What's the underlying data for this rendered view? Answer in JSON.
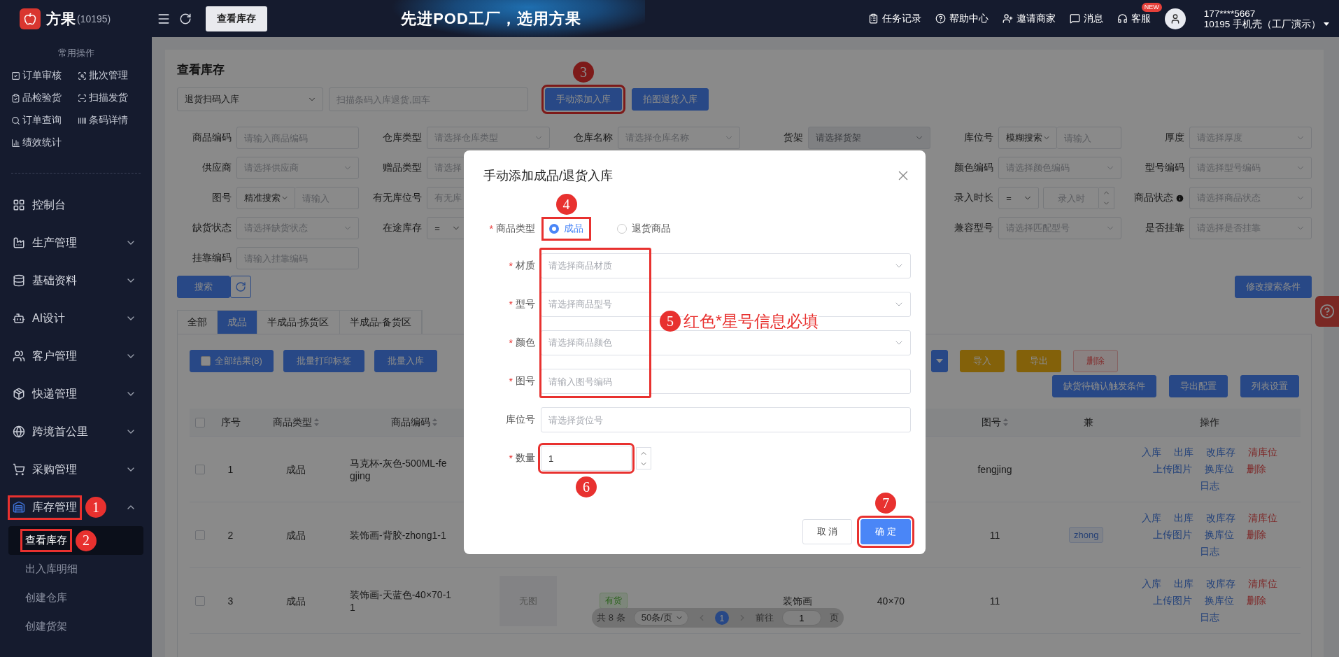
{
  "topbar": {
    "brand": "方果",
    "brand_id": "(10195)",
    "page_button": "查看库存",
    "slogan": "先进POD工厂，选用方果",
    "links": [
      {
        "label": "任务记录"
      },
      {
        "label": "帮助中心"
      },
      {
        "label": "邀请商家"
      },
      {
        "label": "消息"
      },
      {
        "label": "客服",
        "badge": "NEW"
      }
    ],
    "user": {
      "phone": "177****5667",
      "account": "10195 手机壳（工厂演示）"
    }
  },
  "sidebar": {
    "quick_title": "常用操作",
    "quick_actions": [
      "订单审核",
      "批次管理",
      "品检验货",
      "扫描发货",
      "订单查询",
      "条码详情",
      "绩效统计"
    ],
    "menu": [
      {
        "label": "控制台"
      },
      {
        "label": "生产管理",
        "expandable": true,
        "expanded": false
      },
      {
        "label": "基础资料",
        "expandable": true,
        "expanded": false
      },
      {
        "label": "AI设计",
        "expandable": true,
        "expanded": false
      },
      {
        "label": "客户管理",
        "expandable": true,
        "expanded": false
      },
      {
        "label": "快递管理",
        "expandable": true,
        "expanded": false
      },
      {
        "label": "跨境首公里",
        "expandable": true,
        "expanded": false
      },
      {
        "label": "采购管理",
        "expandable": true,
        "expanded": false
      },
      {
        "label": "库存管理",
        "expandable": true,
        "expanded": true,
        "marker": "1",
        "children": [
          {
            "label": "查看库存",
            "selected": true,
            "marker": "2"
          },
          {
            "label": "出入库明细",
            "selected": false
          },
          {
            "label": "创建仓库",
            "selected": false
          },
          {
            "label": "创建货架",
            "selected": false
          }
        ]
      }
    ]
  },
  "page": {
    "title": "查看库存",
    "scan_mode": "退货扫码入库",
    "scan_placeholder": "扫描条码入库退货,回车",
    "scan_buttons": [
      {
        "label": "手动添加入库",
        "marker": "3"
      },
      {
        "label": "拍图退货入库"
      }
    ],
    "filters": [
      [
        {
          "kind": "input",
          "label": "商品编码",
          "placeholder": "请输入商品编码",
          "disabled": false
        },
        {
          "kind": "select",
          "label": "仓库类型",
          "placeholder": "请选择仓库类型",
          "disabled": false
        },
        {
          "kind": "select",
          "label": "仓库名称",
          "placeholder": "请选择仓库名称",
          "disabled": false
        },
        {
          "kind": "select",
          "label": "货架",
          "placeholder": "请选择货架",
          "disabled": true
        },
        {
          "kind": "combo",
          "label": "库位号",
          "mode": "模糊搜索",
          "placeholder": "请输入",
          "disabled": false
        },
        {
          "kind": "select",
          "label": "厚度",
          "placeholder": "请选择厚度",
          "disabled": false
        }
      ],
      [
        {
          "kind": "select",
          "label": "供应商",
          "placeholder": "请选择供应商",
          "disabled": false
        },
        {
          "kind": "cut",
          "label": "赠品类型",
          "placeholder": "请选择",
          "disabled": false
        },
        {
          "kind": "covered"
        },
        {
          "kind": "covered"
        },
        {
          "kind": "select",
          "label": "颜色编码",
          "placeholder": "请选择颜色编码",
          "disabled": false
        },
        {
          "kind": "select",
          "label": "型号编码",
          "placeholder": "请选择型号编码",
          "disabled": false
        }
      ],
      [
        {
          "kind": "combo",
          "label": "图号",
          "mode": "精准搜索",
          "placeholder": "请输入",
          "disabled": false
        },
        {
          "kind": "cut",
          "label": "有无库位号",
          "placeholder": "有无库",
          "disabled": false
        },
        {
          "kind": "covered"
        },
        {
          "kind": "covered"
        },
        {
          "kind": "compare",
          "label": "录入时长",
          "mode": "=",
          "placeholder": "录入时",
          "disabled": false
        },
        {
          "kind": "select",
          "label": "商品状态",
          "info": true,
          "placeholder": "请选择商品状态",
          "disabled": false
        }
      ],
      [
        {
          "kind": "select",
          "label": "缺货状态",
          "placeholder": "请选择缺货状态",
          "disabled": false
        },
        {
          "kind": "compare",
          "label": "在途库存",
          "mode": "=",
          "disabled": false
        },
        {
          "kind": "covered"
        },
        {
          "kind": "covered"
        },
        {
          "kind": "select",
          "label": "兼容型号",
          "placeholder": "请选择匹配型号",
          "disabled": false
        },
        {
          "kind": "select",
          "label": "是否挂靠",
          "placeholder": "请选择是否挂靠",
          "disabled": false
        }
      ],
      [
        {
          "kind": "input",
          "label": "挂靠编码",
          "placeholder": "请输入挂靠编码",
          "disabled": false
        }
      ]
    ],
    "search_button": "搜索",
    "edit_conditions_button": "修改搜索条件",
    "tabs": [
      {
        "label": "全部",
        "selected": false
      },
      {
        "label": "成品",
        "selected": true
      },
      {
        "label": "半成品-拣货区",
        "selected": false
      },
      {
        "label": "半成品-备货区",
        "selected": false
      }
    ],
    "toolbar_left": [
      {
        "kind": "check",
        "label": "全部结果(8)",
        "checked": false
      },
      {
        "kind": "primary",
        "label": "批量打印标签"
      },
      {
        "kind": "primary",
        "label": "批量入库"
      }
    ],
    "toolbar_right": [
      {
        "kind": "caret"
      },
      {
        "kind": "warning",
        "label": "导入"
      },
      {
        "kind": "warning",
        "label": "导出"
      },
      {
        "kind": "danger",
        "label": "删除"
      }
    ],
    "toolbar_second": [
      {
        "kind": "primary",
        "label": "缺货待确认触发条件"
      },
      {
        "kind": "primary",
        "label": "导出配置"
      },
      {
        "kind": "primary",
        "label": "列表设置"
      }
    ],
    "table": {
      "columns": [
        {
          "kind": "checkbox",
          "checked": false
        },
        {
          "kind": "label",
          "label": "序号",
          "sortable": false
        },
        {
          "kind": "label",
          "label": "商品类型",
          "sortable": true
        },
        {
          "kind": "label",
          "label": "商品编码",
          "sortable": true
        },
        {
          "kind": "covered"
        },
        {
          "kind": "covered"
        },
        {
          "kind": "covered"
        },
        {
          "kind": "covered"
        },
        {
          "kind": "covered"
        },
        {
          "kind": "label",
          "label": "图号",
          "sortable": true
        },
        {
          "kind": "label",
          "label": "兼",
          "sortable": false
        },
        {
          "kind": "label",
          "label": "操作",
          "sortable": false
        }
      ],
      "rows": [
        {
          "cells": [
            {
              "kind": "checkbox",
              "checked": false
            },
            {
              "kind": "text",
              "text": "1"
            },
            {
              "kind": "text",
              "text": "成品"
            },
            {
              "kind": "lines",
              "lines": [
                "马克杯-灰色-500ML-fe",
                "gjing"
              ]
            },
            {
              "kind": "covered"
            },
            {
              "kind": "covered"
            },
            {
              "kind": "covered"
            },
            {
              "kind": "covered"
            },
            {
              "kind": "covered"
            },
            {
              "kind": "text",
              "text": "fengjing"
            },
            {
              "kind": "empty"
            },
            {
              "kind": "ops",
              "lines": [
                [
                  {
                    "label": "入库",
                    "danger": false
                  },
                  {
                    "label": "出库",
                    "danger": false
                  },
                  {
                    "label": "改库存",
                    "danger": false
                  },
                  {
                    "label": "清库位",
                    "danger": true
                  }
                ],
                [
                  {
                    "label": "上传图片",
                    "danger": false
                  },
                  {
                    "label": "换库位",
                    "danger": false
                  },
                  {
                    "label": "删除",
                    "danger": true
                  }
                ],
                [
                  {
                    "label": "日志",
                    "danger": false
                  }
                ]
              ]
            }
          ]
        },
        {
          "cells": [
            {
              "kind": "checkbox",
              "checked": false
            },
            {
              "kind": "text",
              "text": "2"
            },
            {
              "kind": "text",
              "text": "成品"
            },
            {
              "kind": "lines",
              "lines": [
                "装饰画-背胶-zhong1-1"
              ]
            },
            {
              "kind": "covered"
            },
            {
              "kind": "covered"
            },
            {
              "kind": "covered"
            },
            {
              "kind": "covered"
            },
            {
              "kind": "covered"
            },
            {
              "kind": "text",
              "text": "11"
            },
            {
              "kind": "chip",
              "text": "zhong"
            },
            {
              "kind": "ops",
              "lines": [
                [
                  {
                    "label": "入库",
                    "danger": false
                  },
                  {
                    "label": "出库",
                    "danger": false
                  },
                  {
                    "label": "改库存",
                    "danger": false
                  },
                  {
                    "label": "清库位",
                    "danger": true
                  }
                ],
                [
                  {
                    "label": "上传图片",
                    "danger": false
                  },
                  {
                    "label": "换库位",
                    "danger": false
                  },
                  {
                    "label": "删除",
                    "danger": true
                  }
                ],
                [
                  {
                    "label": "日志",
                    "danger": false
                  }
                ]
              ]
            }
          ]
        },
        {
          "cells": [
            {
              "kind": "checkbox",
              "checked": false
            },
            {
              "kind": "text",
              "text": "3"
            },
            {
              "kind": "text",
              "text": "成品"
            },
            {
              "kind": "lines",
              "lines": [
                "装饰画-天蓝色-40×70-1",
                "1"
              ]
            },
            {
              "kind": "image",
              "text": "无图"
            },
            {
              "kind": "status",
              "text": "有货"
            },
            {
              "kind": "empty"
            },
            {
              "kind": "text",
              "text": "装饰画"
            },
            {
              "kind": "text",
              "text": "40×70"
            },
            {
              "kind": "text",
              "text": "11"
            },
            {
              "kind": "empty"
            },
            {
              "kind": "ops",
              "lines": [
                [
                  {
                    "label": "入库",
                    "danger": false
                  },
                  {
                    "label": "出库",
                    "danger": false
                  },
                  {
                    "label": "改库存",
                    "danger": false
                  },
                  {
                    "label": "清库位",
                    "danger": true
                  }
                ],
                [
                  {
                    "label": "上传图片",
                    "danger": false
                  },
                  {
                    "label": "换库位",
                    "danger": false
                  },
                  {
                    "label": "删除",
                    "danger": true
                  }
                ],
                [
                  {
                    "label": "日志",
                    "danger": false
                  }
                ]
              ]
            }
          ]
        }
      ]
    },
    "pagination": {
      "total": "共 8 条",
      "page_size": "50条/页",
      "pages": [
        {
          "label": "1",
          "selected": true
        }
      ],
      "goto_label": "前往",
      "goto_value": "1",
      "goto_suffix": "页"
    }
  },
  "dialog": {
    "title": "手动添加成品/退货入库",
    "type_label": "商品类型",
    "type_required": true,
    "type_required_mark": "*",
    "type_options": [
      {
        "label": "成品",
        "selected": true,
        "marker": "4"
      },
      {
        "label": "退货商品",
        "selected": false
      }
    ],
    "marked_fields": [
      {
        "label": "材质",
        "required": true,
        "required_mark": "*",
        "kind": "select",
        "placeholder": "请选择商品材质"
      },
      {
        "label": "型号",
        "required": true,
        "required_mark": "*",
        "kind": "select",
        "placeholder": "请选择商品型号"
      },
      {
        "label": "颜色",
        "required": true,
        "required_mark": "*",
        "kind": "select",
        "placeholder": "请选择商品颜色"
      },
      {
        "label": "图号",
        "required": true,
        "required_mark": "*",
        "kind": "input",
        "placeholder": "请输入图号编码"
      }
    ],
    "required_note": {
      "marker": "5",
      "text": "红色*星号信息必填"
    },
    "other_fields": [
      {
        "label": "库位号",
        "required": false,
        "kind": "input",
        "placeholder": "请选择货位号"
      },
      {
        "label": "数量",
        "required": true,
        "required_mark": "*",
        "kind": "number",
        "value": "1",
        "marker": "6"
      }
    ],
    "buttons": [
      {
        "label": "取 消",
        "kind": "default"
      },
      {
        "label": "确 定",
        "kind": "primary",
        "marker": "7"
      }
    ]
  }
}
